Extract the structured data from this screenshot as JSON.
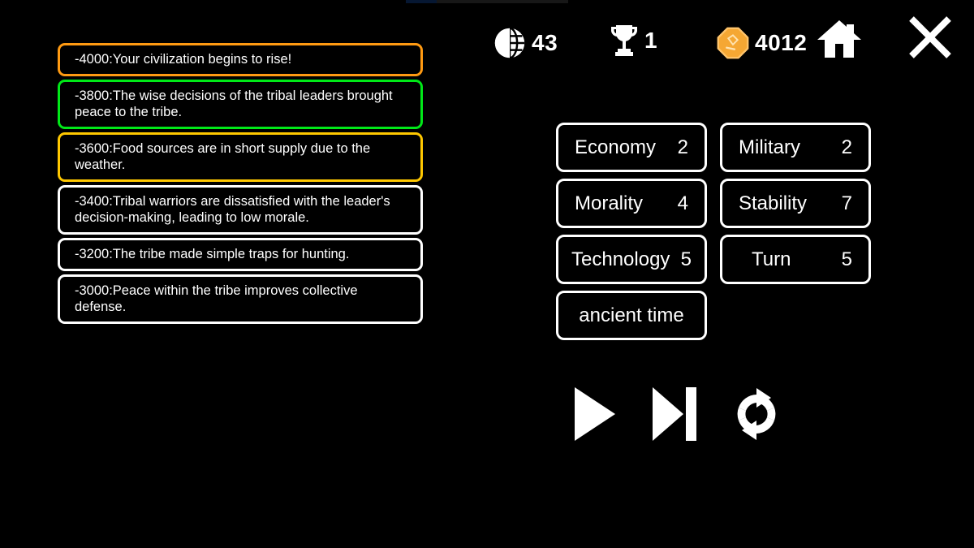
{
  "screen": {
    "background": "#000000",
    "title": "Civilization Turn Screen"
  },
  "top_residual": {
    "name": "top-residual-bar"
  },
  "event_log": {
    "entries": [
      {
        "text": "-4000:Your civilization begins to rise!",
        "accent": "orange",
        "accent_color": "#ff9a12"
      },
      {
        "text": "-3800:The wise decisions of the tribal leaders brought peace to the tribe.",
        "accent": "green",
        "accent_color": "#00e818"
      },
      {
        "text": "-3600:Food sources are in short supply due to the weather.",
        "accent": "gold",
        "accent_color": "#ffc800"
      },
      {
        "text": "-3400:Tribal warriors are dissatisfied with the leader's decision-making, leading to low morale.",
        "accent": "white",
        "accent_color": "#ffffff"
      },
      {
        "text": "-3200:The tribe made simple traps for hunting.",
        "accent": "white",
        "accent_color": "#ffffff"
      },
      {
        "text": "-3000:Peace within the tribe improves collective defense.",
        "accent": "white",
        "accent_color": "#ffffff"
      }
    ]
  },
  "hud": {
    "population": {
      "icon": "globe-icon",
      "value": "43"
    },
    "score": {
      "icon": "trophy-icon",
      "value": "1"
    },
    "gold": {
      "icon": "coin-icon",
      "value": "4012",
      "color": "#f5a733"
    },
    "home": {
      "icon": "home-icon"
    },
    "close": {
      "icon": "close-icon"
    }
  },
  "stats": [
    {
      "label": "Economy",
      "value": "2",
      "layout": "split"
    },
    {
      "label": "Military",
      "value": "2",
      "layout": "split"
    },
    {
      "label": "Morality",
      "value": "4",
      "layout": "split"
    },
    {
      "label": "Stability",
      "value": "7",
      "layout": "split"
    },
    {
      "label": "Technology",
      "value": "5",
      "layout": "split"
    },
    {
      "label": "Turn",
      "value": "5",
      "layout": "split"
    },
    {
      "label": "ancient time",
      "value": "",
      "layout": "center"
    }
  ],
  "controls": [
    {
      "name": "play-button",
      "icon": "play-icon"
    },
    {
      "name": "next-button",
      "icon": "skip-next-icon"
    },
    {
      "name": "restart-button",
      "icon": "refresh-icon"
    }
  ]
}
